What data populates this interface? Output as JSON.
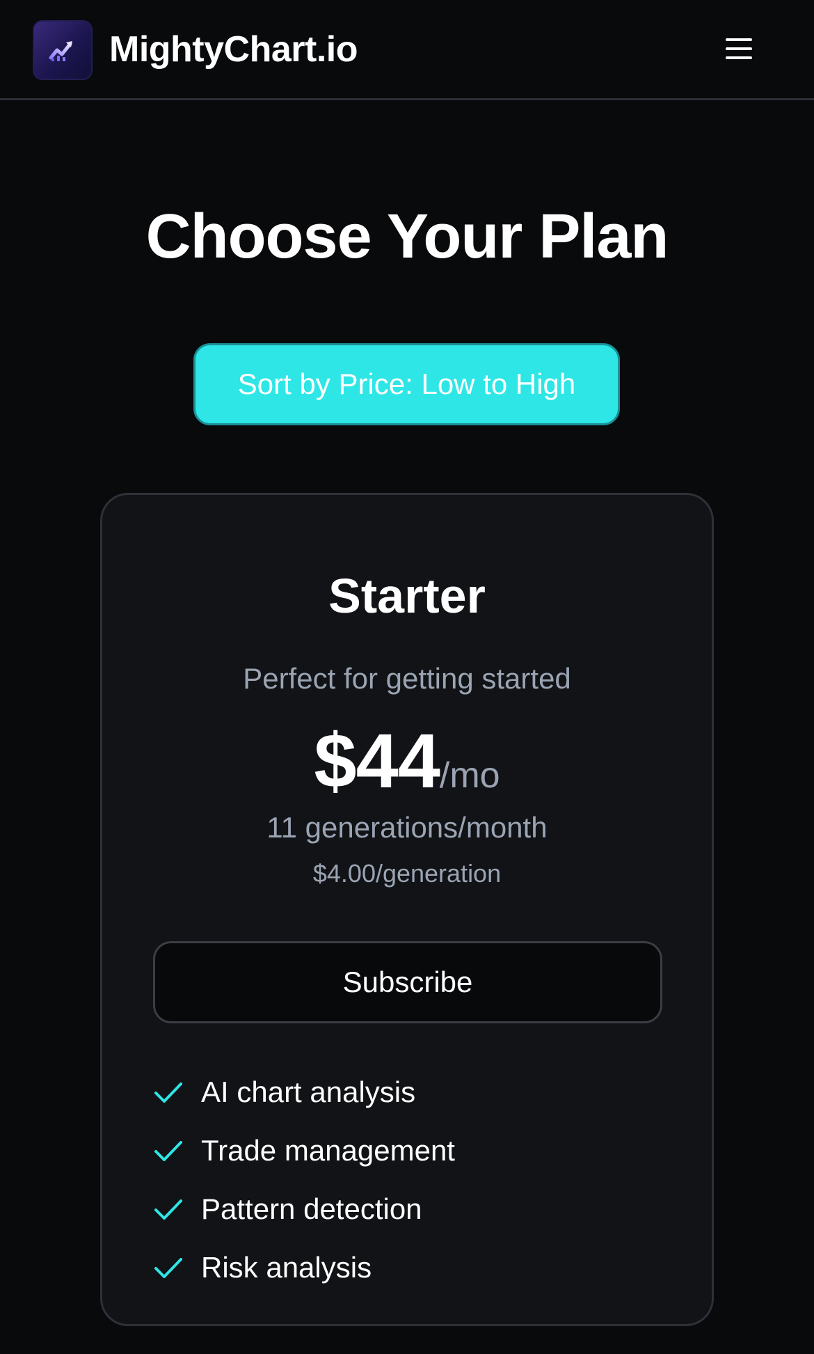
{
  "header": {
    "brand": "MightyChart.io",
    "logo_icon": "rising-chart-icon",
    "menu_icon": "hamburger-menu-icon"
  },
  "main": {
    "title": "Choose Your Plan",
    "sort_label": "Sort by Price: Low to High"
  },
  "plan": {
    "name": "Starter",
    "tagline": "Perfect for getting started",
    "price": "$44",
    "period": "/mo",
    "quota": "11 generations/month",
    "unit_price": "$4.00/generation",
    "cta_label": "Subscribe",
    "features": [
      "AI chart analysis",
      "Trade management",
      "Pattern detection",
      "Risk analysis"
    ]
  },
  "colors": {
    "background": "#090a0c",
    "card": "#111316",
    "accent": "#2ee6e6",
    "muted_text": "#9ba4b3",
    "check": "#2ee6e6"
  }
}
